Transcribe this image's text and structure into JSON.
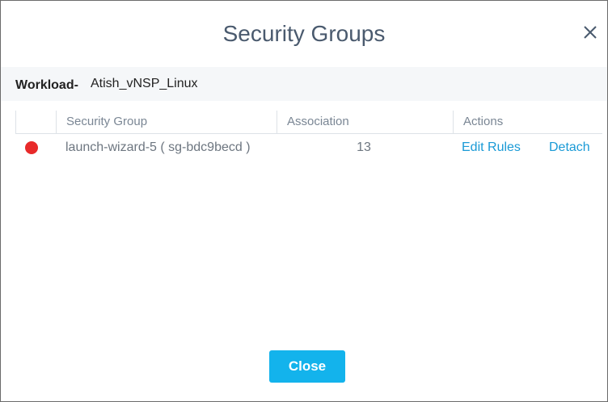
{
  "dialog": {
    "title": "Security Groups"
  },
  "workload": {
    "label": "Workload-",
    "value": "Atish_vNSP_Linux"
  },
  "table": {
    "columns": [
      "Security Group",
      "Association",
      "Actions"
    ],
    "rows": [
      {
        "status_color": "#e82a2a",
        "security_group": "launch-wizard-5 ( sg-bdc9becd )",
        "association": "13",
        "action_edit": "Edit Rules",
        "action_detach": "Detach"
      }
    ]
  },
  "footer": {
    "close_label": "Close"
  },
  "icons": {
    "close": "close-icon",
    "status": "status-dot-icon"
  },
  "colors": {
    "accent": "#13b3ec",
    "link": "#1a9ad6",
    "title": "#4a5a6e",
    "status_error": "#e82a2a"
  }
}
